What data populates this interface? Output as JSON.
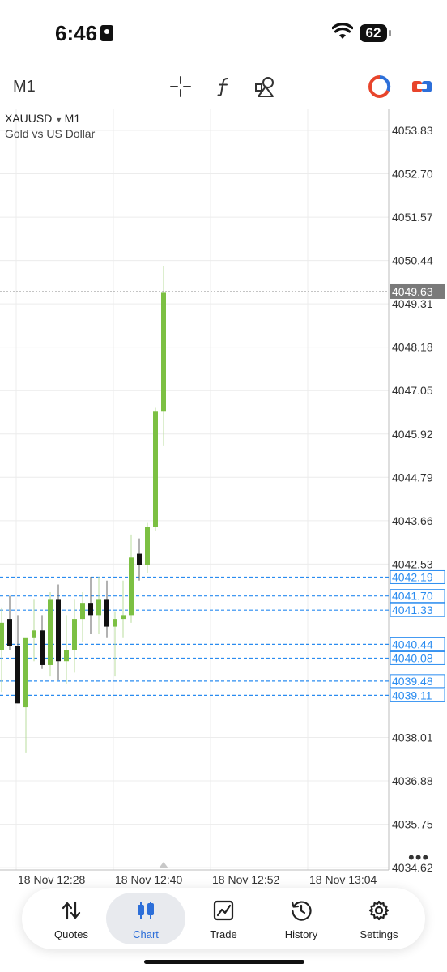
{
  "status_bar": {
    "time": "6:46",
    "battery": "62"
  },
  "toolbar": {
    "timeframe": "M1"
  },
  "chart_data": {
    "type": "candlestick",
    "symbol": "XAUUSD",
    "timeframe": "M1",
    "description": "Gold vs US Dollar",
    "current_price": "4049.63",
    "ylim": [
      4034.2,
      4054.4
    ],
    "y_ticks": [
      "4053.83",
      "4052.70",
      "4051.57",
      "4050.44",
      "4049.31",
      "4048.18",
      "4047.05",
      "4045.92",
      "4044.79",
      "4043.66",
      "4042.53",
      "4038.01",
      "4036.88",
      "4035.75",
      "4034.62"
    ],
    "order_lines": [
      "4042.19",
      "4041.70",
      "4041.33",
      "4040.44",
      "4040.08",
      "4039.48",
      "4039.11"
    ],
    "x_ticks": [
      "18 Nov 12:28",
      "18 Nov 12:40",
      "18 Nov 12:52",
      "18 Nov 13:04"
    ],
    "candles": [
      {
        "o": 4040.3,
        "h": 4041.4,
        "l": 4039.2,
        "c": 4041.0
      },
      {
        "o": 4041.1,
        "h": 4041.7,
        "l": 4040.3,
        "c": 4040.4
      },
      {
        "o": 4040.4,
        "h": 4041.2,
        "l": 4038.9,
        "c": 4038.9
      },
      {
        "o": 4038.8,
        "h": 4039.8,
        "l": 4037.6,
        "c": 4040.6
      },
      {
        "o": 4040.6,
        "h": 4041.6,
        "l": 4040.0,
        "c": 4040.8
      },
      {
        "o": 4040.8,
        "h": 4041.2,
        "l": 4039.8,
        "c": 4039.9
      },
      {
        "o": 4039.9,
        "h": 4041.8,
        "l": 4039.6,
        "c": 4041.6
      },
      {
        "o": 4041.6,
        "h": 4042.0,
        "l": 4039.5,
        "c": 4040.0
      },
      {
        "o": 4040.0,
        "h": 4041.2,
        "l": 4039.4,
        "c": 4040.3
      },
      {
        "o": 4040.3,
        "h": 4041.6,
        "l": 4039.7,
        "c": 4041.1
      },
      {
        "o": 4041.1,
        "h": 4041.8,
        "l": 4040.5,
        "c": 4041.5
      },
      {
        "o": 4041.5,
        "h": 4042.2,
        "l": 4040.7,
        "c": 4041.2
      },
      {
        "o": 4041.2,
        "h": 4042.2,
        "l": 4040.7,
        "c": 4041.6
      },
      {
        "o": 4041.6,
        "h": 4042.1,
        "l": 4040.6,
        "c": 4040.9
      },
      {
        "o": 4040.9,
        "h": 4041.3,
        "l": 4039.6,
        "c": 4041.1
      },
      {
        "o": 4041.1,
        "h": 4042.1,
        "l": 4040.6,
        "c": 4041.2
      },
      {
        "o": 4041.2,
        "h": 4043.3,
        "l": 4041.0,
        "c": 4042.7
      },
      {
        "o": 4042.8,
        "h": 4043.2,
        "l": 4042.1,
        "c": 4042.5
      },
      {
        "o": 4042.5,
        "h": 4043.6,
        "l": 4042.3,
        "c": 4043.5
      },
      {
        "o": 4043.5,
        "h": 4046.6,
        "l": 4043.4,
        "c": 4046.5
      },
      {
        "o": 4046.5,
        "h": 4050.3,
        "l": 4045.6,
        "c": 4049.6
      }
    ],
    "up_color": "#7cc043",
    "down_color": "#111111",
    "order_color": "#2a8cf0",
    "grid": true
  },
  "tabs": [
    {
      "label": "Quotes",
      "icon": "quotes-arrows-icon"
    },
    {
      "label": "Chart",
      "icon": "candlestick-icon",
      "active": true
    },
    {
      "label": "Trade",
      "icon": "trade-chart-icon"
    },
    {
      "label": "History",
      "icon": "history-clock-icon"
    },
    {
      "label": "Settings",
      "icon": "gear-icon"
    }
  ]
}
